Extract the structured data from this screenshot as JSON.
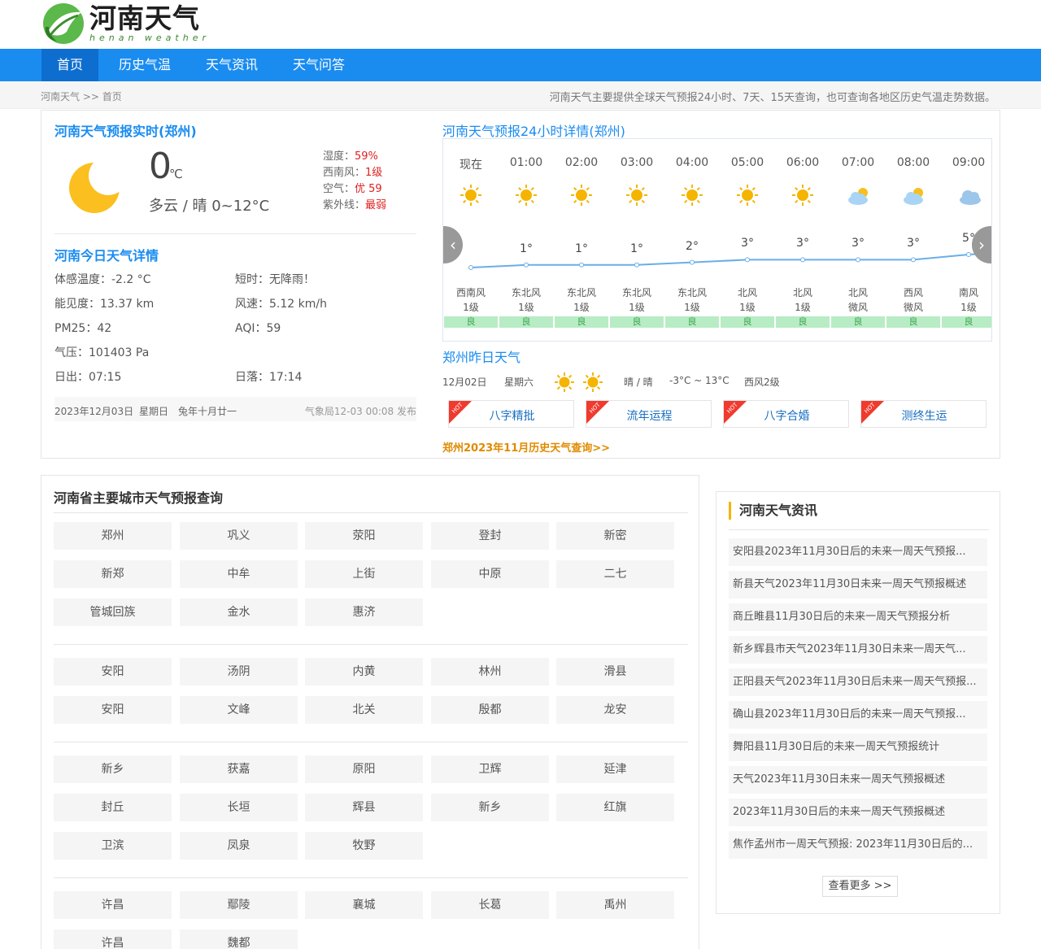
{
  "site": {
    "logo_cn": "河南天气",
    "logo_en": "henan weather",
    "colors": {
      "primary": "#1a8cf0",
      "nav_active": "#0d6ed0",
      "accent_red": "#e02020",
      "link_orange": "#e08a00",
      "aqi_green": "#b8ecc5"
    }
  },
  "nav": {
    "items": [
      {
        "label": "首页",
        "active": true
      },
      {
        "label": "历史气温",
        "active": false
      },
      {
        "label": "天气资讯",
        "active": false
      },
      {
        "label": "天气问答",
        "active": false
      }
    ]
  },
  "breadcrumb": {
    "root": "河南天气",
    "sep": ">>",
    "current": "首页"
  },
  "site_description": "河南天气主要提供全球天气预报24小时、7天、15天查询，也可查询各地区历史气温走势数据。",
  "realtime": {
    "title": "河南天气预报实时(郑州)",
    "icon": "moon-icon",
    "temp": "0",
    "unit": "℃",
    "condition": "多云 / 晴 0~12°C",
    "humidity_label": "湿度：",
    "humidity_value": "59%",
    "wind_label": "西南风：",
    "wind_value": "1级",
    "air_label": "空气：",
    "air_value": "优 59",
    "uv_label": "紫外线：",
    "uv_value": "最弱"
  },
  "today": {
    "title": "河南今日天气详情",
    "items": [
      "体感温度：-2.2 °C",
      "短时：无降雨！",
      "能见度：13.37 km",
      "风速：5.12 km/h",
      "PM25：42",
      "AQI：59",
      "气压：101403 Pa",
      "日出：07:15",
      "日落：17:14"
    ],
    "date": "2023年12月03日",
    "weekday": "星期日",
    "lunar": "兔年十月廿一",
    "issued": "气象局12-03 00:08 发布"
  },
  "hourly": {
    "title": "河南天气预报24小时详情(郑州)",
    "hours": [
      {
        "time": "现在",
        "icon": "sun-icon",
        "temp": "",
        "temp_value": 0,
        "wind_dir": "西南风",
        "wind_level": "1级",
        "aqi": "良"
      },
      {
        "time": "01:00",
        "icon": "sun-icon",
        "temp": "1°",
        "temp_value": 1,
        "wind_dir": "东北风",
        "wind_level": "1级",
        "aqi": "良"
      },
      {
        "time": "02:00",
        "icon": "sun-icon",
        "temp": "1°",
        "temp_value": 1,
        "wind_dir": "东北风",
        "wind_level": "1级",
        "aqi": "良"
      },
      {
        "time": "03:00",
        "icon": "sun-icon",
        "temp": "1°",
        "temp_value": 1,
        "wind_dir": "东北风",
        "wind_level": "1级",
        "aqi": "良"
      },
      {
        "time": "04:00",
        "icon": "sun-icon",
        "temp": "2°",
        "temp_value": 2,
        "wind_dir": "东北风",
        "wind_level": "1级",
        "aqi": "良"
      },
      {
        "time": "05:00",
        "icon": "sun-icon",
        "temp": "3°",
        "temp_value": 3,
        "wind_dir": "北风",
        "wind_level": "1级",
        "aqi": "良"
      },
      {
        "time": "06:00",
        "icon": "sun-icon",
        "temp": "3°",
        "temp_value": 3,
        "wind_dir": "北风",
        "wind_level": "1级",
        "aqi": "良"
      },
      {
        "time": "07:00",
        "icon": "partly-cloudy-icon",
        "temp": "3°",
        "temp_value": 3,
        "wind_dir": "北风",
        "wind_level": "微风",
        "aqi": "良"
      },
      {
        "time": "08:00",
        "icon": "partly-cloudy-icon",
        "temp": "3°",
        "temp_value": 3,
        "wind_dir": "西风",
        "wind_level": "微风",
        "aqi": "良"
      },
      {
        "time": "09:00",
        "icon": "cloud-icon",
        "temp": "5°",
        "temp_value": 5,
        "wind_dir": "南风",
        "wind_level": "1级",
        "aqi": "良"
      }
    ]
  },
  "yesterday": {
    "title": "郑州昨日天气",
    "date": "12月02日",
    "weekday": "星期六",
    "condition": "晴 / 晴",
    "temp_range": "-3°C ~ 13°C",
    "wind": "西风2级"
  },
  "tags": [
    {
      "label": "八字精批",
      "hot": "HOT"
    },
    {
      "label": "流年运程",
      "hot": "HOT"
    },
    {
      "label": "八字合婚",
      "hot": "HOT"
    },
    {
      "label": "测终生运",
      "hot": "HOT"
    }
  ],
  "history_link": "郑州2023年11月历史天气查询>>",
  "cities": {
    "title": "河南省主要城市天气预报查询",
    "groups": [
      [
        "郑州",
        "巩义",
        "荥阳",
        "登封",
        "新密",
        "新郑",
        "中牟",
        "上街",
        "中原",
        "二七",
        "管城回族",
        "金水",
        "惠济"
      ],
      [
        "安阳",
        "汤阴",
        "内黄",
        "林州",
        "滑县",
        "安阳",
        "文峰",
        "北关",
        "殷都",
        "龙安"
      ],
      [
        "新乡",
        "获嘉",
        "原阳",
        "卫辉",
        "延津",
        "封丘",
        "长垣",
        "辉县",
        "新乡",
        "红旗",
        "卫滨",
        "凤泉",
        "牧野"
      ],
      [
        "许昌",
        "鄢陵",
        "襄城",
        "长葛",
        "禹州",
        "许昌",
        "魏都"
      ]
    ]
  },
  "news": {
    "title": "河南天气资讯",
    "items": [
      "安阳县2023年11月30日后的未来一周天气预报...",
      "新县天气2023年11月30日未来一周天气预报概述",
      "商丘睢县11月30日后的未来一周天气预报分析",
      "新乡辉县市天气2023年11月30日未来一周天气...",
      "正阳县天气2023年11月30日后未来一周天气预报...",
      "确山县2023年11月30日后的未来一周天气预报...",
      "舞阳县11月30日后的未来一周天气预报统计",
      "天气2023年11月30日未来一周天气预报概述",
      "2023年11月30日后的未来一周天气预报概述",
      "焦作孟州市一周天气预报: 2023年11月30日后的..."
    ],
    "more_label": "查看更多 >>"
  }
}
